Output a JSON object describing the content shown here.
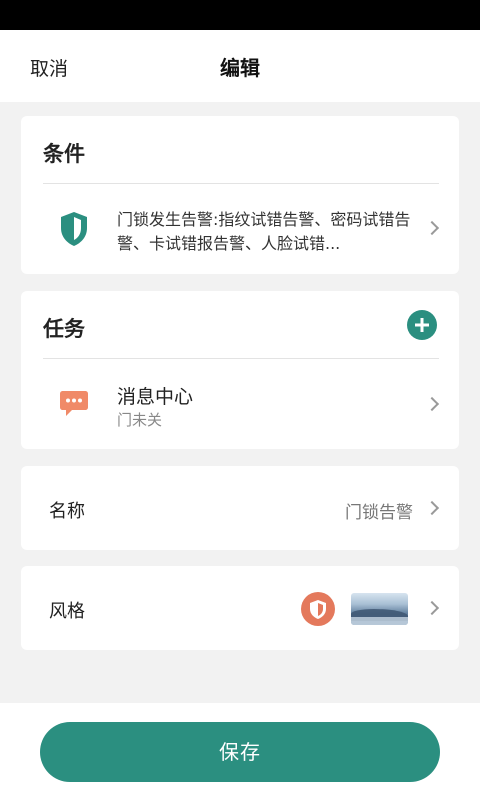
{
  "nav": {
    "cancel_label": "取消",
    "title": "编辑"
  },
  "condition": {
    "section_title": "条件",
    "description": "门锁发生告警:指纹试错告警、密码试错告警、卡试错报告警、人脸试错...",
    "icon": "shield-icon"
  },
  "task": {
    "section_title": "任务",
    "add_icon": "plus-icon",
    "item": {
      "title": "消息中心",
      "subtitle": "门未关",
      "icon": "chat-bubble-icon"
    }
  },
  "name_row": {
    "label": "名称",
    "value": "门锁告警"
  },
  "style_row": {
    "label": "风格",
    "badge_icon": "shield-icon",
    "thumbnail": "landscape-thumbnail"
  },
  "save_label": "保存",
  "colors": {
    "accent": "#2b8f80",
    "badge": "#e4795c",
    "message_icon": "#f08a68"
  }
}
